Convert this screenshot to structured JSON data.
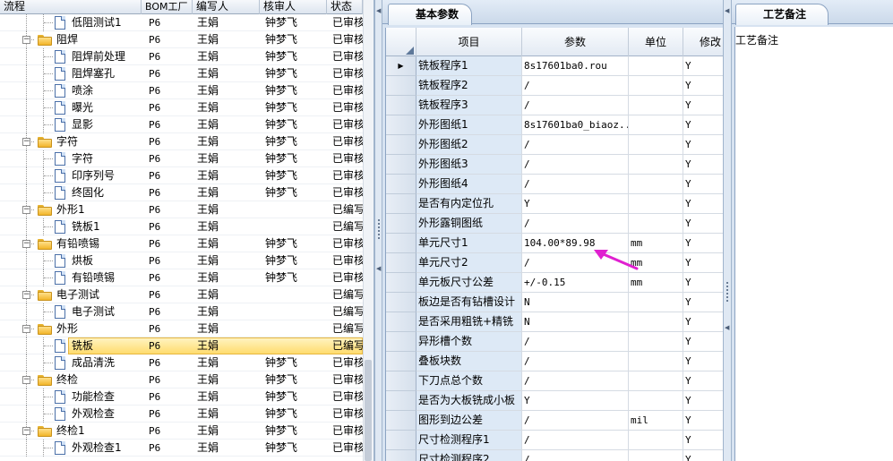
{
  "tree": {
    "columns": [
      "流程",
      "BOM工厂",
      "编写人",
      "核审人",
      "状态"
    ],
    "rows": [
      {
        "name": "低阻测试1",
        "type": "doc",
        "depth": 2,
        "factory": "P6",
        "writer": "王娟",
        "reviewer": "钟梦飞",
        "status": "已审核"
      },
      {
        "name": "阻焊",
        "type": "folder",
        "depth": 1,
        "factory": "P6",
        "writer": "王娟",
        "reviewer": "钟梦飞",
        "status": "已审核"
      },
      {
        "name": "阻焊前处理",
        "type": "doc",
        "depth": 2,
        "factory": "P6",
        "writer": "王娟",
        "reviewer": "钟梦飞",
        "status": "已审核"
      },
      {
        "name": "阻焊塞孔",
        "type": "doc",
        "depth": 2,
        "factory": "P6",
        "writer": "王娟",
        "reviewer": "钟梦飞",
        "status": "已审核"
      },
      {
        "name": "喷涂",
        "type": "doc",
        "depth": 2,
        "factory": "P6",
        "writer": "王娟",
        "reviewer": "钟梦飞",
        "status": "已审核"
      },
      {
        "name": "曝光",
        "type": "doc",
        "depth": 2,
        "factory": "P6",
        "writer": "王娟",
        "reviewer": "钟梦飞",
        "status": "已审核"
      },
      {
        "name": "显影",
        "type": "doc",
        "depth": 2,
        "factory": "P6",
        "writer": "王娟",
        "reviewer": "钟梦飞",
        "status": "已审核"
      },
      {
        "name": "字符",
        "type": "folder",
        "depth": 1,
        "factory": "P6",
        "writer": "王娟",
        "reviewer": "钟梦飞",
        "status": "已审核"
      },
      {
        "name": "字符",
        "type": "doc",
        "depth": 2,
        "factory": "P6",
        "writer": "王娟",
        "reviewer": "钟梦飞",
        "status": "已审核"
      },
      {
        "name": "印序列号",
        "type": "doc",
        "depth": 2,
        "factory": "P6",
        "writer": "王娟",
        "reviewer": "钟梦飞",
        "status": "已审核"
      },
      {
        "name": "终固化",
        "type": "doc",
        "depth": 2,
        "factory": "P6",
        "writer": "王娟",
        "reviewer": "钟梦飞",
        "status": "已审核"
      },
      {
        "name": "外形1",
        "type": "folder",
        "depth": 1,
        "factory": "P6",
        "writer": "王娟",
        "reviewer": "",
        "status": "已编写"
      },
      {
        "name": "铣板1",
        "type": "doc",
        "depth": 2,
        "factory": "P6",
        "writer": "王娟",
        "reviewer": "",
        "status": "已编写"
      },
      {
        "name": "有铅喷锡",
        "type": "folder",
        "depth": 1,
        "factory": "P6",
        "writer": "王娟",
        "reviewer": "钟梦飞",
        "status": "已审核"
      },
      {
        "name": "烘板",
        "type": "doc",
        "depth": 2,
        "factory": "P6",
        "writer": "王娟",
        "reviewer": "钟梦飞",
        "status": "已审核"
      },
      {
        "name": "有铅喷锡",
        "type": "doc",
        "depth": 2,
        "factory": "P6",
        "writer": "王娟",
        "reviewer": "钟梦飞",
        "status": "已审核"
      },
      {
        "name": "电子测试",
        "type": "folder",
        "depth": 1,
        "factory": "P6",
        "writer": "王娟",
        "reviewer": "",
        "status": "已编写"
      },
      {
        "name": "电子测试",
        "type": "doc",
        "depth": 2,
        "factory": "P6",
        "writer": "王娟",
        "reviewer": "",
        "status": "已编写"
      },
      {
        "name": "外形",
        "type": "folder",
        "depth": 1,
        "factory": "P6",
        "writer": "王娟",
        "reviewer": "",
        "status": "已编写"
      },
      {
        "name": "铣板",
        "type": "doc",
        "depth": 2,
        "factory": "P6",
        "writer": "王娟",
        "reviewer": "",
        "status": "已编写",
        "selected": true
      },
      {
        "name": "成品清洗",
        "type": "doc",
        "depth": 2,
        "factory": "P6",
        "writer": "王娟",
        "reviewer": "钟梦飞",
        "status": "已审核"
      },
      {
        "name": "终检",
        "type": "folder",
        "depth": 1,
        "factory": "P6",
        "writer": "王娟",
        "reviewer": "钟梦飞",
        "status": "已审核"
      },
      {
        "name": "功能检查",
        "type": "doc",
        "depth": 2,
        "factory": "P6",
        "writer": "王娟",
        "reviewer": "钟梦飞",
        "status": "已审核"
      },
      {
        "name": "外观检查",
        "type": "doc",
        "depth": 2,
        "factory": "P6",
        "writer": "王娟",
        "reviewer": "钟梦飞",
        "status": "已审核"
      },
      {
        "name": "终检1",
        "type": "folder",
        "depth": 1,
        "factory": "P6",
        "writer": "王娟",
        "reviewer": "钟梦飞",
        "status": "已审核"
      },
      {
        "name": "外观检查1",
        "type": "doc",
        "depth": 2,
        "factory": "P6",
        "writer": "王娟",
        "reviewer": "钟梦飞",
        "status": "已审核"
      }
    ]
  },
  "params": {
    "tab_label": "基本参数",
    "columns": [
      "项目",
      "参数",
      "单位",
      "修改"
    ],
    "rows": [
      {
        "item": "铣板程序1",
        "value": "8s17601ba0.rou",
        "unit": "",
        "modify": "Y",
        "current": true
      },
      {
        "item": "铣板程序2",
        "value": "/",
        "unit": "",
        "modify": "Y"
      },
      {
        "item": "铣板程序3",
        "value": "/",
        "unit": "",
        "modify": "Y"
      },
      {
        "item": "外形图纸1",
        "value": "8s17601ba0_biaoz...",
        "unit": "",
        "modify": "Y"
      },
      {
        "item": "外形图纸2",
        "value": "/",
        "unit": "",
        "modify": "Y"
      },
      {
        "item": "外形图纸3",
        "value": "/",
        "unit": "",
        "modify": "Y"
      },
      {
        "item": "外形图纸4",
        "value": "/",
        "unit": "",
        "modify": "Y"
      },
      {
        "item": "是否有内定位孔",
        "value": "Y",
        "unit": "",
        "modify": "Y"
      },
      {
        "item": "外形露铜图纸",
        "value": "/",
        "unit": "",
        "modify": "Y"
      },
      {
        "item": "单元尺寸1",
        "value": "104.00*89.98",
        "unit": "mm",
        "modify": "Y"
      },
      {
        "item": "单元尺寸2",
        "value": "/",
        "unit": "mm",
        "modify": "Y"
      },
      {
        "item": "单元板尺寸公差",
        "value": "+/-0.15",
        "unit": "mm",
        "modify": "Y"
      },
      {
        "item": "板边是否有钻槽设计",
        "value": "N",
        "unit": "",
        "modify": "Y"
      },
      {
        "item": "是否采用粗铣+精铣",
        "value": "N",
        "unit": "",
        "modify": "Y"
      },
      {
        "item": "异形槽个数",
        "value": "/",
        "unit": "",
        "modify": "Y"
      },
      {
        "item": "叠板块数",
        "value": "/",
        "unit": "",
        "modify": "Y"
      },
      {
        "item": "下刀点总个数",
        "value": "/",
        "unit": "",
        "modify": "Y"
      },
      {
        "item": "是否为大板铣成小板",
        "value": "Y",
        "unit": "",
        "modify": "Y"
      },
      {
        "item": "图形到边公差",
        "value": "/",
        "unit": "mil",
        "modify": "Y"
      },
      {
        "item": "尺寸检测程序1",
        "value": "/",
        "unit": "",
        "modify": "Y"
      },
      {
        "item": "尺寸检测程序2",
        "value": "/",
        "unit": "",
        "modify": "Y"
      }
    ]
  },
  "notes": {
    "tab_label": "工艺备注",
    "field_label": "工艺备注"
  },
  "colors": {
    "accent": "#d7e3f1",
    "selection": "#ffdc6e",
    "annotation_arrow": "#e020d0"
  },
  "icons": {
    "folder": "folder-icon",
    "document": "document-icon",
    "expander": "collapse-icon",
    "current_row": "row-pointer-icon"
  }
}
